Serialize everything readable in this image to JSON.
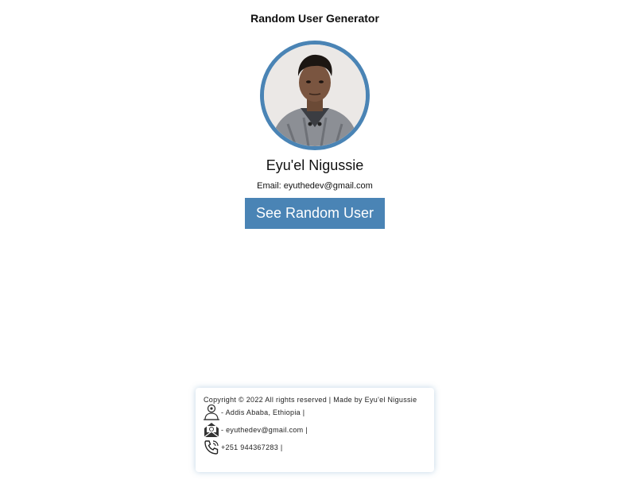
{
  "app": {
    "title": "Random User Generator"
  },
  "user": {
    "name": "Eyu'el Nigussie",
    "email_label": "Email: ",
    "email": "eyuthedev@gmail.com",
    "photo_alt": "user-photo"
  },
  "actions": {
    "random_label": "See Random User"
  },
  "footer": {
    "copyright": "Copyright © 2022 All rights reserved | Made by Eyu'el Nigussie",
    "address": "- Addis Ababa, Ethiopia |",
    "email": "- eyuthedev@gmail.com |",
    "phone": "+251 944367283 |"
  },
  "icons": {
    "address": "location-person-icon",
    "email": "envelope-icon",
    "phone": "phone-icon"
  },
  "colors": {
    "accent": "#4a84b5",
    "background": "#ffffff"
  }
}
